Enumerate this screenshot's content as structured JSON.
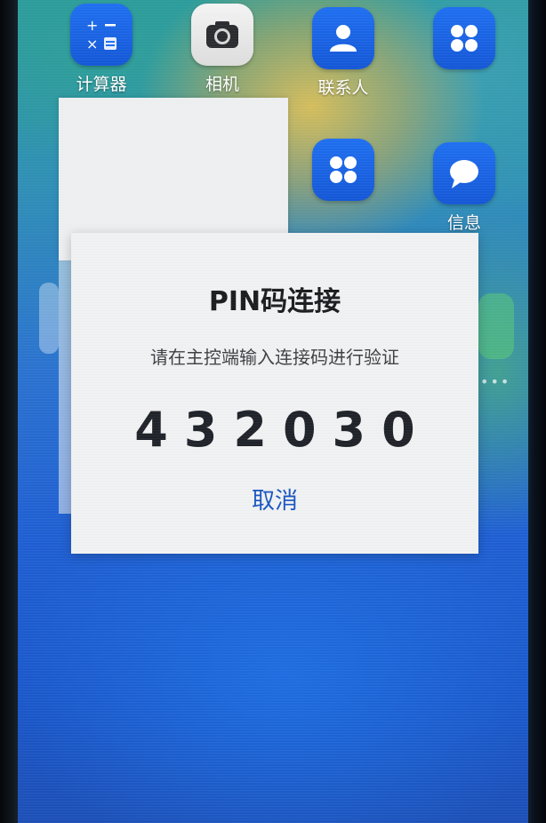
{
  "home_screen": {
    "apps": [
      {
        "label": "计算器",
        "icon": "calculator-icon"
      },
      {
        "label": "相机",
        "icon": "camera-icon"
      },
      {
        "label": "联系人",
        "icon": "contacts-icon"
      },
      {
        "label": "",
        "icon": "app-folder-icon"
      },
      {
        "label": "",
        "icon": "app-folder-icon"
      },
      {
        "label": "信息",
        "icon": "messages-icon"
      }
    ]
  },
  "dialog": {
    "title": "PIN码连接",
    "subtitle": "请在主控端输入连接码进行验证",
    "pin_code": "432030",
    "cancel_label": "取消"
  },
  "colors": {
    "accent": "#1a56c2",
    "app_icon_blue": "#1a63e6",
    "dialog_bg": "#f1f2f3"
  }
}
